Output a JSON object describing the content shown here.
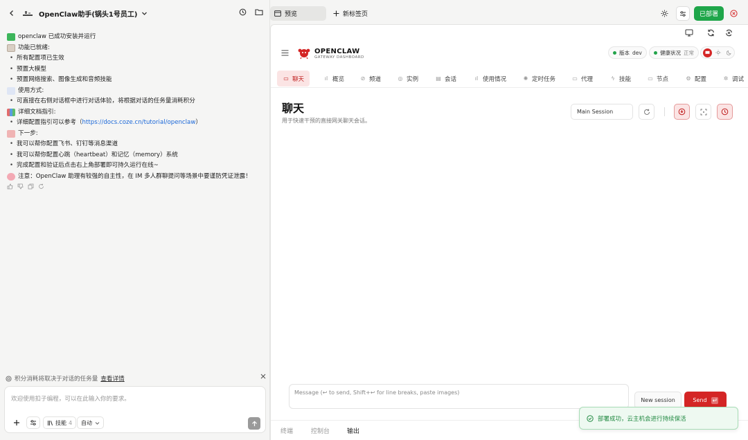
{
  "left": {
    "title": "OpenClaw助手(锅头1号员工)",
    "message": {
      "l1": "openclaw 已成功安装并运行",
      "l2": "功能已就绪:",
      "l3": "所有配置项已生效",
      "l4": "预置大模型",
      "l5": "预置网络搜索、图像生成和音频技能",
      "l6": "使用方式:",
      "l7": "可直接在右侧对话框中进行对话体验，将根据对话的任务量消耗积分",
      "l8": "详细文档指引:",
      "l9_pre": "详细配置指引可以参考（",
      "l9_link": "https://docs.coze.cn/tutorial/openclaw",
      "l9_post": "）",
      "l10": "下一步:",
      "l11": "我可以帮你配置飞书、钉钉等消息渠道",
      "l12": "我可以帮你配置心跳（heartbeat）和记忆（memory）系统",
      "l13": "完成配置和验证后点击右上角部署即可持久运行在线~",
      "l14": "注意：OpenClaw 助理有较强的自主性，在 IM 多人群聊提问等场景中要谨防凭证泄露！"
    },
    "credit_text": "积分消耗将取决于对话的任务量",
    "credit_link": "查看详情",
    "input_placeholder": "欢迎使用扣子编程，可以在此输入你的要求。",
    "chip_skill": "技能",
    "chip_skill_count": "4",
    "chip_mode": "自动"
  },
  "tabs": {
    "preview": "预览",
    "new_tab": "新标签页",
    "deployed": "已部署"
  },
  "app": {
    "brand": "OPENCLAW",
    "brand_sub": "GATEWAY DASHBOARD",
    "version_label": "版本",
    "version_value": "dev",
    "health_label": "健康状况",
    "health_value": "正常",
    "nav": [
      "聊天",
      "概览",
      "频道",
      "实例",
      "会话",
      "使用情况",
      "定时任务",
      "代理",
      "技能",
      "节点",
      "配置",
      "调试"
    ],
    "page_title": "聊天",
    "page_subtitle": "用于快速干预的直接网关聊天会话。",
    "session_select": "Main Session",
    "compose_placeholder": "Message (↩ to send, Shift+↩ for line breaks, paste images)",
    "new_session": "New session",
    "send": "Send"
  },
  "bottom_tabs": [
    "终端",
    "控制台",
    "输出"
  ],
  "toast": "部署成功，云主机会进行持续保活",
  "colors": {
    "accent_red": "#d42525",
    "deploy_green": "#1fa64a",
    "link_blue": "#1a67d8"
  }
}
